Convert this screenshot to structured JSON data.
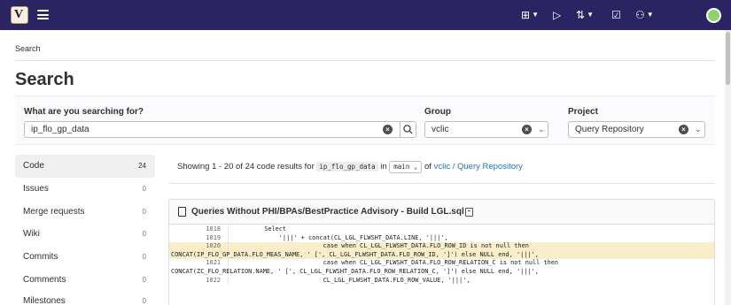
{
  "nav": {
    "logo_letter": "V",
    "icons": [
      {
        "name": "plus-square-icon",
        "glyph": "⊞"
      },
      {
        "name": "issues-icon",
        "glyph": "▷"
      },
      {
        "name": "merge-request-icon",
        "glyph": "⇅"
      },
      {
        "name": "todo-icon",
        "glyph": "☑"
      },
      {
        "name": "help-icon",
        "glyph": "⚇"
      }
    ],
    "background": "#2a2562"
  },
  "breadcrumb": "Search",
  "page_title": "Search",
  "search": {
    "label": "What are you searching for?",
    "value": "ip_flo_gp_data",
    "group_label": "Group",
    "group_value": "vclic",
    "project_label": "Project",
    "project_value": "Query Repository"
  },
  "sidebar": {
    "items": [
      {
        "label": "Code",
        "count": "24"
      },
      {
        "label": "Issues",
        "count": "0"
      },
      {
        "label": "Merge requests",
        "count": "0"
      },
      {
        "label": "Wiki",
        "count": "0"
      },
      {
        "label": "Commits",
        "count": "0"
      },
      {
        "label": "Comments",
        "count": "0"
      },
      {
        "label": "Milestones",
        "count": "0"
      }
    ]
  },
  "results": {
    "prefix": "Showing 1 - 20 of 24 code results for",
    "term": "ip_flo_gp_data",
    "in_text": "in",
    "branch": "main",
    "of_text": "of",
    "scope_link": "vclic / Query Repository"
  },
  "file": {
    "title": "Queries Without PHI/BPAs/BestPractice Advisory - Build LGL.sql",
    "lines": [
      {
        "num": "1018",
        "code": "        Select",
        "highlight": false
      },
      {
        "num": "1019",
        "code": "            '|||' + concat(CL_LGL_FLWSHT_DATA.LINE, '|||',",
        "highlight": false
      },
      {
        "num": "1020",
        "code": "                        case when CL_LGL_FLWSHT_DATA.FLO_ROW_ID is not null then",
        "highlight": true
      },
      {
        "num": "",
        "code": "CONCAT(IP_FLO_GP_DATA.FLO_MEAS_NAME, ' [', CL_LGL_FLWSHT_DATA.FLO_ROW_ID, ']') else NULL end, '|||',",
        "highlight": true
      },
      {
        "num": "1021",
        "code": "                        case when CL_LGL_FLWSHT_DATA.FLO_ROW_RELATION_C is not null then",
        "highlight": false
      },
      {
        "num": "",
        "code": "CONCAT(ZC_FLO_RELATION.NAME, ' [', CL_LGL_FLWSHT_DATA.FLO_ROW_RELATION_C, ']') else NULL end, '|||',",
        "highlight": false
      },
      {
        "num": "1022",
        "code": "                        CL_LGL_FLWSHT_DATA.FLO_ROW_VALUE, '|||',",
        "highlight": false
      }
    ]
  }
}
